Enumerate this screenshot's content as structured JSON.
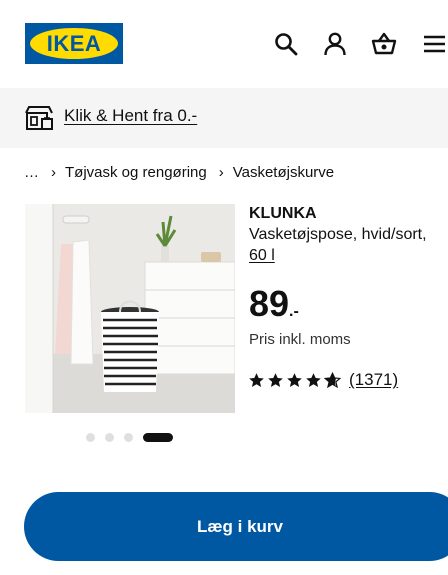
{
  "brand": {
    "logo_text": "IKEA",
    "colors": {
      "blue": "#0058a3",
      "yellow": "#ffdb00"
    }
  },
  "header": {
    "icons": [
      "search-icon",
      "user-icon",
      "basket-icon",
      "menu-icon"
    ]
  },
  "promo": {
    "text": "Klik & Hent fra 0.-",
    "icon": "store-icon"
  },
  "breadcrumb": {
    "ellipsis": "…",
    "items": [
      "Tøjvask og rengøring",
      "Vasketøjskurve"
    ],
    "separator": "›"
  },
  "product": {
    "name": "KLUNKA",
    "description": "Vasketøjspose, hvid/sort,",
    "size": "60 l",
    "price_main": "89",
    "price_suffix": ".-",
    "price_note": "Pris inkl. moms",
    "rating": {
      "stars": 4.5,
      "max": 5,
      "count": "(1371)"
    }
  },
  "gallery": {
    "total": 4,
    "active_index": 3
  },
  "actions": {
    "add_to_cart": "Læg i kurv"
  }
}
